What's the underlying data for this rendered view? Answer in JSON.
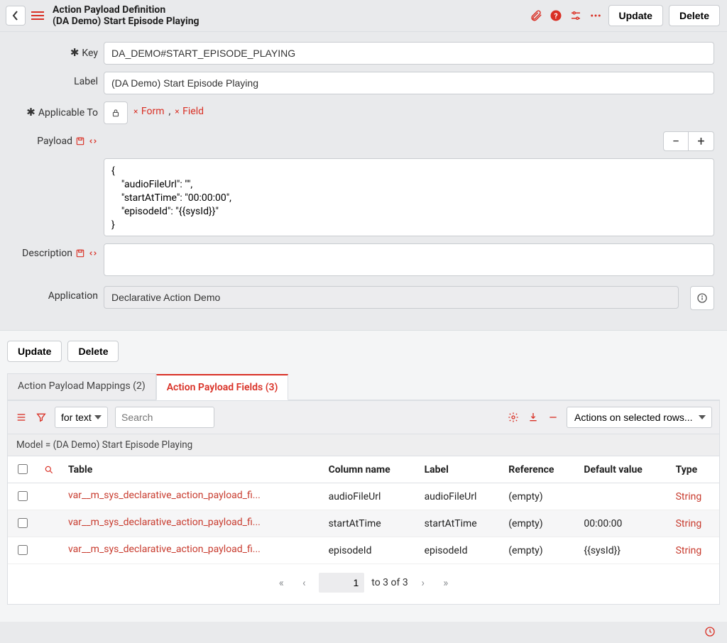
{
  "header": {
    "title1": "Action Payload Definition",
    "title2": "(DA Demo) Start Episode Playing",
    "update": "Update",
    "delete": "Delete"
  },
  "form": {
    "key_label": "Key",
    "key_value": "DA_DEMO#START_EPISODE_PLAYING",
    "label_label": "Label",
    "label_value": "(DA Demo) Start Episode Playing",
    "applicable_label": "Applicable To",
    "applicable_pill1": "Form",
    "applicable_pill2": "Field",
    "payload_label": "Payload",
    "payload_value": "{\n    \"audioFileUrl\": \"\",\n    \"startAtTime\": \"00:00:00\",\n    \"episodeId\": \"{{sysId}}\"\n}",
    "description_label": "Description",
    "description_value": "",
    "application_label": "Application",
    "application_value": "Declarative Action Demo"
  },
  "lower": {
    "update": "Update",
    "delete": "Delete",
    "tab1": "Action Payload Mappings (2)",
    "tab2": "Action Payload Fields (3)",
    "search_mode": "for text",
    "search_placeholder": "Search",
    "actions_placeholder": "Actions on selected rows...",
    "model_text": "Model = (DA Demo) Start Episode Playing",
    "cols": {
      "table": "Table",
      "column": "Column name",
      "label": "Label",
      "reference": "Reference",
      "default": "Default value",
      "type": "Type"
    },
    "rows": [
      {
        "table": "var__m_sys_declarative_action_payload_fi...",
        "column": "audioFileUrl",
        "label": "audioFileUrl",
        "reference": "(empty)",
        "default": "",
        "type": "String"
      },
      {
        "table": "var__m_sys_declarative_action_payload_fi...",
        "column": "startAtTime",
        "label": "startAtTime",
        "reference": "(empty)",
        "default": "00:00:00",
        "type": "String"
      },
      {
        "table": "var__m_sys_declarative_action_payload_fi...",
        "column": "episodeId",
        "label": "episodeId",
        "reference": "(empty)",
        "default": "{{sysId}}",
        "type": "String"
      }
    ],
    "pager": {
      "page": "1",
      "range": "to 3 of 3"
    }
  }
}
